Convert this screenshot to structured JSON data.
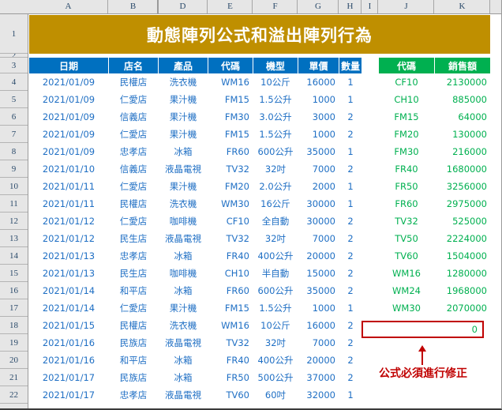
{
  "window": {
    "title": "動態陣列公式和溢出陣列行為"
  },
  "grid": {
    "column_headers": [
      "A",
      "B",
      "D",
      "E",
      "F",
      "G",
      "H",
      "I",
      "J",
      "K"
    ],
    "row_headers": [
      "1",
      "2",
      "3",
      "4",
      "5",
      "6",
      "7",
      "8",
      "9",
      "10",
      "11",
      "12",
      "13",
      "14",
      "15",
      "16",
      "17",
      "18",
      "19",
      "20",
      "21",
      "22"
    ],
    "hidden_column_after": "B"
  },
  "title": {
    "text": "動態陣列公式和溢出陣列行為",
    "background": "#BF8F00",
    "color": "#FFFFFF"
  },
  "left_table": {
    "header_background": "#0070C0",
    "header_color": "#FFFFFF",
    "text_color": "#1F6FC4",
    "columns": [
      "日期",
      "店名",
      "產品",
      "代碼",
      "機型",
      "單價",
      "數量"
    ],
    "rows": [
      [
        "2021/01/09",
        "民權店",
        "洗衣機",
        "WM16",
        "10公斤",
        "16000",
        "1"
      ],
      [
        "2021/01/09",
        "仁愛店",
        "果汁機",
        "FM15",
        "1.5公升",
        "1000",
        "1"
      ],
      [
        "2021/01/09",
        "信義店",
        "果汁機",
        "FM30",
        "3.0公升",
        "3000",
        "2"
      ],
      [
        "2021/01/09",
        "仁愛店",
        "果汁機",
        "FM15",
        "1.5公升",
        "1000",
        "2"
      ],
      [
        "2021/01/09",
        "忠孝店",
        "冰箱",
        "FR60",
        "600公升",
        "35000",
        "1"
      ],
      [
        "2021/01/10",
        "信義店",
        "液晶電視",
        "TV32",
        "32吋",
        "7000",
        "2"
      ],
      [
        "2021/01/11",
        "仁愛店",
        "果汁機",
        "FM20",
        "2.0公升",
        "2000",
        "1"
      ],
      [
        "2021/01/11",
        "民權店",
        "洗衣機",
        "WM30",
        "16公斤",
        "30000",
        "1"
      ],
      [
        "2021/01/12",
        "仁愛店",
        "咖啡機",
        "CF10",
        "全自動",
        "30000",
        "2"
      ],
      [
        "2021/01/12",
        "民生店",
        "液晶電視",
        "TV32",
        "32吋",
        "7000",
        "2"
      ],
      [
        "2021/01/13",
        "忠孝店",
        "冰箱",
        "FR40",
        "400公升",
        "20000",
        "2"
      ],
      [
        "2021/01/13",
        "民生店",
        "咖啡機",
        "CH10",
        "半自動",
        "15000",
        "2"
      ],
      [
        "2021/01/14",
        "和平店",
        "冰箱",
        "FR60",
        "600公升",
        "35000",
        "2"
      ],
      [
        "2021/01/14",
        "仁愛店",
        "果汁機",
        "FM15",
        "1.5公升",
        "1000",
        "1"
      ],
      [
        "2021/01/15",
        "民權店",
        "洗衣機",
        "WM16",
        "10公斤",
        "16000",
        "2"
      ],
      [
        "2021/01/16",
        "民族店",
        "液晶電視",
        "TV32",
        "32吋",
        "7000",
        "2"
      ],
      [
        "2021/01/16",
        "和平店",
        "冰箱",
        "FR40",
        "400公升",
        "20000",
        "2"
      ],
      [
        "2021/01/17",
        "民族店",
        "冰箱",
        "FR50",
        "500公升",
        "37000",
        "2"
      ],
      [
        "2021/01/17",
        "忠孝店",
        "液晶電視",
        "TV60",
        "60吋",
        "32000",
        "1"
      ]
    ]
  },
  "right_table": {
    "header_background": "#00B050",
    "header_color": "#FFFFFF",
    "text_color": "#00B050",
    "columns": [
      "代碼",
      "銷售額"
    ],
    "rows": [
      [
        "CF10",
        "2130000"
      ],
      [
        "CH10",
        "885000"
      ],
      [
        "FM15",
        "64000"
      ],
      [
        "FM20",
        "130000"
      ],
      [
        "FM30",
        "216000"
      ],
      [
        "FR40",
        "1680000"
      ],
      [
        "FR50",
        "3256000"
      ],
      [
        "FR60",
        "2975000"
      ],
      [
        "TV32",
        "525000"
      ],
      [
        "TV50",
        "2224000"
      ],
      [
        "TV60",
        "1504000"
      ],
      [
        "WM16",
        "1280000"
      ],
      [
        "WM24",
        "1968000"
      ],
      [
        "WM30",
        "2070000"
      ]
    ],
    "error_cell": {
      "code": "",
      "value": "0",
      "border_color": "#C00000"
    },
    "annotation": {
      "text": "公式必須進行修正",
      "color": "#C00000"
    }
  }
}
